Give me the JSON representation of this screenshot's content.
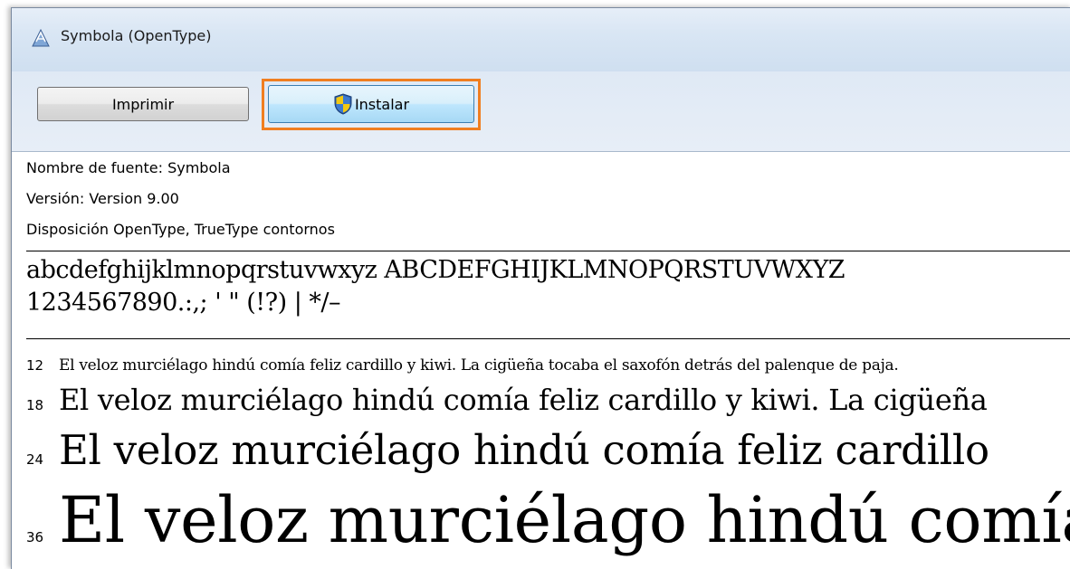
{
  "window": {
    "title": "Symbola (OpenType)"
  },
  "toolbar": {
    "print_label": "Imprimir",
    "install_label": "Instalar"
  },
  "font_info": {
    "name_line": "Nombre de fuente: Symbola",
    "version_line": "Versión: Version 9.00",
    "layout_line": "Disposición OpenType, TrueType  contornos"
  },
  "characters": {
    "letters": "abcdefghijklmnopqrstuvwxyz ABCDEFGHIJKLMNOPQRSTUVWXYZ",
    "digits": "1234567890.:,; ' \" (!?) | */–"
  },
  "samples": [
    {
      "size": "12",
      "text": "El veloz murciélago hindú comía feliz cardillo y kiwi. La cigüeña tocaba el saxofón detrás del palenque de paja."
    },
    {
      "size": "18",
      "text": "El veloz murciélago hindú comía feliz cardillo y kiwi. La cigüeña"
    },
    {
      "size": "24",
      "text": "El veloz murciélago hindú comía feliz cardillo"
    },
    {
      "size": "36",
      "text": "El veloz murciélago hindú comía"
    }
  ],
  "colors": {
    "install_highlight": "#f07e20",
    "titlebar": "#dce8f5"
  },
  "icons": {
    "title": "font-file-icon",
    "install": "uac-shield-icon"
  }
}
